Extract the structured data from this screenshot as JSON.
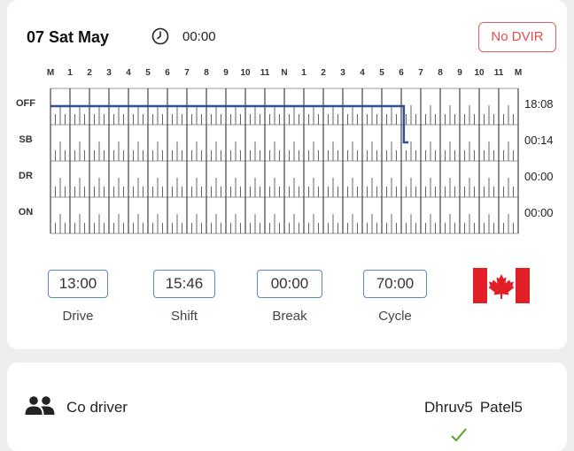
{
  "header": {
    "date": "07 Sat May",
    "clock_icon": "clock-icon",
    "time": "00:00",
    "dvir_badge": "No DVIR",
    "badge_color": "#e05050"
  },
  "log_chart": {
    "hour_labels": [
      "M",
      "1",
      "2",
      "3",
      "4",
      "5",
      "6",
      "7",
      "8",
      "9",
      "10",
      "11",
      "N",
      "1",
      "2",
      "3",
      "4",
      "5",
      "6",
      "7",
      "8",
      "9",
      "10",
      "11",
      "M"
    ],
    "rows": [
      {
        "label": "OFF",
        "total": "18:08"
      },
      {
        "label": "SB",
        "total": "00:14"
      },
      {
        "label": "DR",
        "total": "00:00"
      },
      {
        "label": "ON",
        "total": "00:00"
      }
    ],
    "status_line_color": "#2e4f95",
    "status_segments": [
      {
        "status": "OFF",
        "start_hour": 0,
        "end_hour": 18.13
      },
      {
        "status": "SB",
        "start_hour": 18.13,
        "end_hour": 18.37
      }
    ]
  },
  "stats": [
    {
      "value": "13:00",
      "label": "Drive"
    },
    {
      "value": "15:46",
      "label": "Shift"
    },
    {
      "value": "00:00",
      "label": "Break"
    },
    {
      "value": "70:00",
      "label": "Cycle"
    }
  ],
  "flag": {
    "icon": "canada-flag-icon",
    "color": "#e21e26"
  },
  "co_driver": {
    "icon": "users-icon",
    "label": "Co driver",
    "first_name": "Dhruv5",
    "last_name": "Patel5"
  }
}
